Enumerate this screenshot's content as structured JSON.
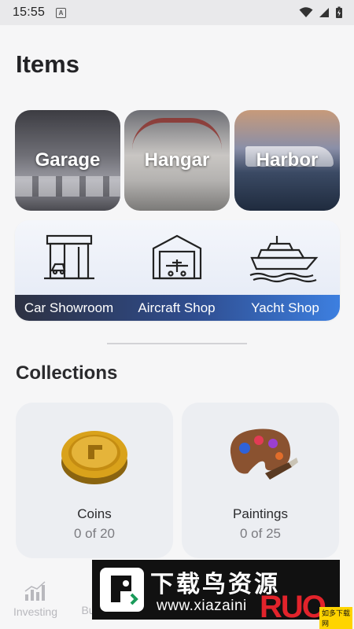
{
  "status_bar": {
    "time": "15:55",
    "a_badge": "A"
  },
  "items_section": {
    "title": "Items",
    "places": [
      {
        "label": "Garage"
      },
      {
        "label": "Hangar"
      },
      {
        "label": "Harbor"
      }
    ],
    "shops": [
      {
        "label": "Car Showroom",
        "icon": "car-showroom-icon"
      },
      {
        "label": "Aircraft Shop",
        "icon": "aircraft-hangar-icon"
      },
      {
        "label": "Yacht Shop",
        "icon": "yacht-icon"
      }
    ]
  },
  "collections_section": {
    "title": "Collections",
    "cards": [
      {
        "name": "Coins",
        "count": "0 of 20",
        "icon": "gold-coin-icon"
      },
      {
        "name": "Paintings",
        "count": "0 of 25",
        "icon": "paint-palette-icon"
      }
    ]
  },
  "bottom_nav": {
    "items": [
      {
        "label": "Investing",
        "icon": "bar-chart-icon"
      },
      {
        "label": "Bu",
        "icon": ""
      }
    ]
  },
  "watermark": {
    "text_cn": "下载鸟资源",
    "url": "www.xiazaini",
    "badge": "RUO",
    "badge_sub": "如多下载网"
  },
  "colors": {
    "accent_blue": "#3d7fe0",
    "coin_gold": "#d4a017",
    "background": "#f6f6f7"
  }
}
